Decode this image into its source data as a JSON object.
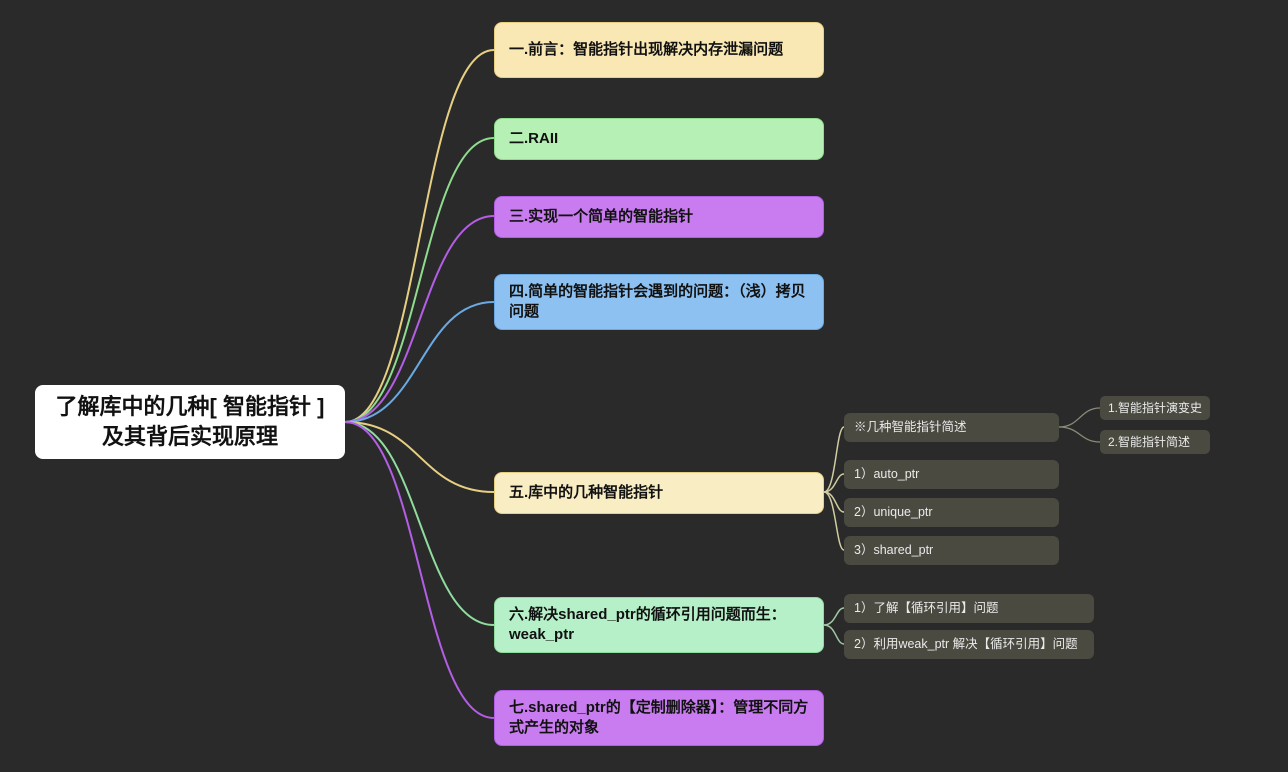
{
  "root": {
    "title": "了解库中的几种[ 智能指针 ]及其背后实现原理"
  },
  "nodes": {
    "n1": "一.前言：智能指针出现解决内存泄漏问题",
    "n2": "二.RAII",
    "n3": "三.实现一个简单的智能指针",
    "n4": "四.简单的智能指针会遇到的问题：（浅）拷贝问题",
    "n5": "五.库中的几种智能指针",
    "n6": "六.解决shared_ptr的循环引用问题而生：weak_ptr",
    "n7": "七.shared_ptr的【定制删除器】：管理不同方式产生的对象"
  },
  "sub5": {
    "s1": "※几种智能指针简述",
    "s2": "1）auto_ptr",
    "s3": "2）unique_ptr",
    "s4": "3）shared_ptr"
  },
  "sub5_1": {
    "a": "1.智能指针演变史",
    "b": "2.智能指针简述"
  },
  "sub6": {
    "s1": "1）了解【循环引用】问题",
    "s2": "2）利用weak_ptr 解决【循环引用】问题"
  }
}
